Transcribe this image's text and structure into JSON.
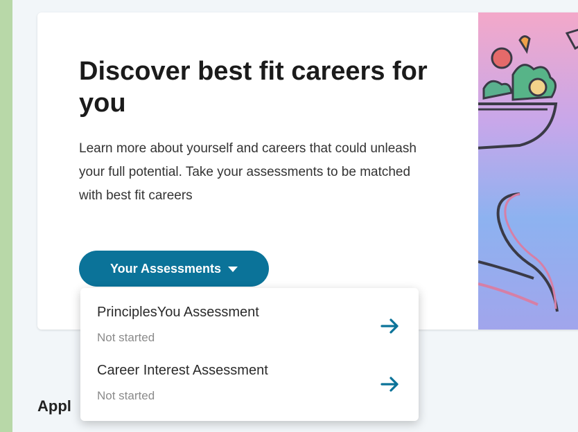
{
  "hero": {
    "title": "Discover best fit careers for you",
    "description": "Learn more about yourself and careers that could unleash your full potential. Take your assessments to be matched with best fit careers",
    "button_label": "Your Assessments"
  },
  "dropdown": {
    "items": [
      {
        "title": "PrinciplesYou Assessment",
        "status": "Not started"
      },
      {
        "title": "Career Interest Assessment",
        "status": "Not started"
      }
    ]
  },
  "next_section": {
    "heading": "Appl"
  },
  "colors": {
    "accent": "#0b7399",
    "arrow": "#0b7399"
  },
  "icons": {
    "button": "caret-down-icon",
    "item": "arrow-right-icon"
  }
}
